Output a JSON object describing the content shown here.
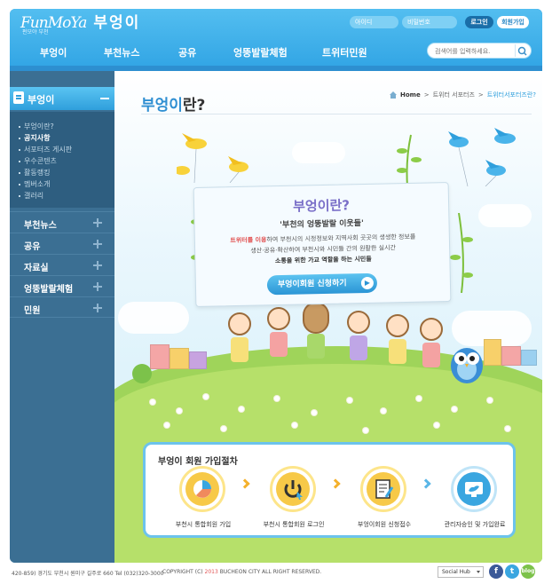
{
  "header": {
    "logo_en": "FunMoYa",
    "logo_kr": "부엉이",
    "logo_sub": "펀모야 부천",
    "login_id_placeholder": "아이디",
    "login_pw_placeholder": "비밀번호",
    "login_button": "로그인",
    "join_button": "회원가입",
    "search_placeholder": "검색어를 입력하세요.",
    "nav": [
      "부엉이",
      "부천뉴스",
      "공유",
      "엉뚱발랄체험",
      "트위터민원"
    ]
  },
  "sidebar": {
    "active_label": "부엉이",
    "submenu": [
      "부엉이란?",
      "공지사항",
      "서포터즈 게시판",
      "우수콘텐츠",
      "활동랭킹",
      "멤버소개",
      "갤러리"
    ],
    "submenu_active": 1,
    "items": [
      "부천뉴스",
      "공유",
      "자료실",
      "엉뚱발랄체험",
      "민원"
    ]
  },
  "main": {
    "title_highlight": "부엉이",
    "title_rest": "란?",
    "breadcrumb": {
      "home": "Home",
      "level1": "트위터 서포터즈",
      "current": "트위터서포터즈란?"
    },
    "banner": {
      "title": "부엉이란?",
      "subtitle": "'부천의 엉뚱발랄 이웃들'",
      "desc_em": "트위터를 이용",
      "desc_1": "하여 부천시의 시정정보와 지역사회 곳곳의 생생한 정보를",
      "desc_2": "생산·공유·확산하여 부천시와 시민들 간의 원활한 실시간",
      "desc_3": "소통을 위한 가교 역할을 하는 시민들",
      "cta": "부엉이회원 신청하기"
    },
    "procedure": {
      "title": "부엉이 회원 가입절차",
      "steps": [
        {
          "label": "부천시 통합회원 가입",
          "icon": "pie-chart-hand-icon",
          "color": "#f7c948"
        },
        {
          "label": "부천시 통합회원 로그인",
          "icon": "power-cursor-icon",
          "color": "#f7c948"
        },
        {
          "label": "부엉이회원 신청접수",
          "icon": "document-pen-icon",
          "color": "#f7c948"
        },
        {
          "label": "관리자승인 및 가입완료",
          "icon": "twitter-bird-icon",
          "color": "#3aa6e0"
        }
      ]
    }
  },
  "footer": {
    "address": "420-859) 경기도 부천시 원미구 길주로 660   Tel (032)320-3000",
    "copyright_pre": "COPYRIGHT (C) ",
    "copyright_year": "2013",
    "copyright_post": " BUCHEON CITY ALL RIGHT RESERVED.",
    "social_select": "Social Hub",
    "blog_label": "blog"
  },
  "colors": {
    "primary": "#33a6e5",
    "sidebar": "#3b6f93",
    "accent_red": "#e25555",
    "banner_title": "#7a6fc8"
  }
}
